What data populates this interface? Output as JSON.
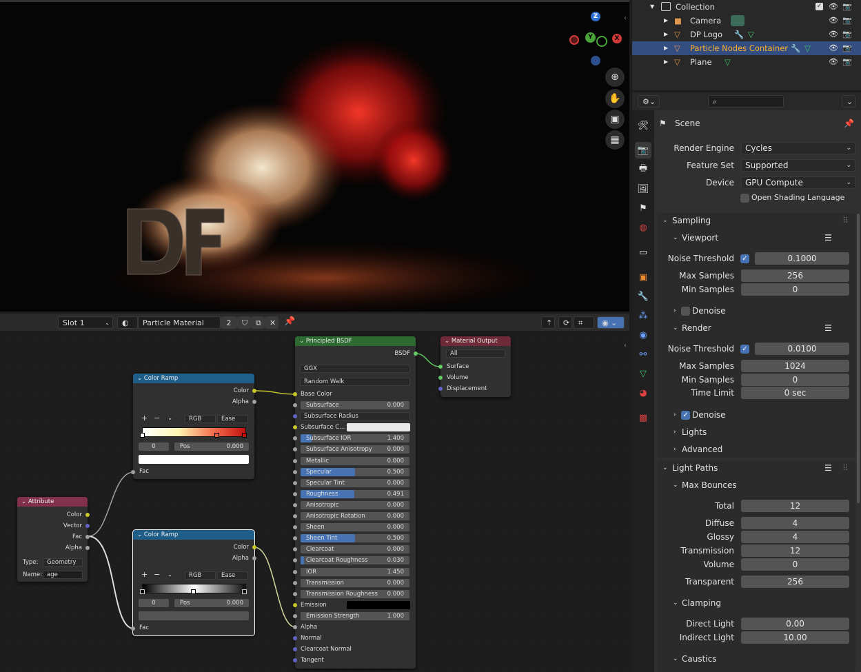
{
  "outliner": {
    "rows": [
      {
        "label": "Collection",
        "icon": "collection-icon"
      },
      {
        "label": "Camera",
        "icon": "camera-icon"
      },
      {
        "label": "DP Logo",
        "icon": "mesh-icon"
      },
      {
        "label": "Particle Nodes Container",
        "icon": "mesh-icon"
      },
      {
        "label": "Plane",
        "icon": "mesh-icon"
      }
    ]
  },
  "viewport": {
    "gizmo": {
      "z": "Z",
      "y": "Y",
      "x": "X"
    }
  },
  "node_header": {
    "slot": "Slot 1",
    "material_name": "Particle Material",
    "users": "2"
  },
  "nodes": {
    "color_ramp_1": {
      "title": "Color Ramp",
      "out_color": "Color",
      "out_alpha": "Alpha",
      "mode": "RGB",
      "interp": "Ease",
      "index": "0",
      "pos_label": "Pos",
      "pos_value": "0.000",
      "in_fac": "Fac",
      "plus": "+",
      "minus": "−"
    },
    "color_ramp_2": {
      "title": "Color Ramp",
      "out_color": "Color",
      "out_alpha": "Alpha",
      "mode": "RGB",
      "interp": "Ease",
      "index": "0",
      "pos_label": "Pos",
      "pos_value": "0.000",
      "in_fac": "Fac",
      "plus": "+",
      "minus": "−"
    },
    "attribute": {
      "title": "Attribute",
      "out_color": "Color",
      "out_vector": "Vector",
      "out_fac": "Fac",
      "out_alpha": "Alpha",
      "type_label": "Type:",
      "type_value": "Geometry",
      "name_label": "Name:",
      "name_value": "age"
    },
    "principled": {
      "title": "Principled BSDF",
      "out_bsdf": "BSDF",
      "distribution": "GGX",
      "subsurface_method": "Random Walk",
      "base_color": "Base Color",
      "fields": [
        {
          "label": "Subsurface",
          "value": "0.000",
          "fill": 0
        },
        {
          "label": "Subsurface IOR",
          "value": "1.400",
          "fill": 0.1
        },
        {
          "label": "Subsurface Anisotropy",
          "value": "0.000",
          "fill": 0
        },
        {
          "label": "Metallic",
          "value": "0.000",
          "fill": 0
        },
        {
          "label": "Specular",
          "value": "0.500",
          "fill": 0.5
        },
        {
          "label": "Specular Tint",
          "value": "0.000",
          "fill": 0
        },
        {
          "label": "Roughness",
          "value": "0.491",
          "fill": 0.491
        },
        {
          "label": "Anisotropic",
          "value": "0.000",
          "fill": 0
        },
        {
          "label": "Anisotropic Rotation",
          "value": "0.000",
          "fill": 0
        },
        {
          "label": "Sheen",
          "value": "0.000",
          "fill": 0
        },
        {
          "label": "Sheen Tint",
          "value": "0.500",
          "fill": 0.5
        },
        {
          "label": "Clearcoat",
          "value": "0.000",
          "fill": 0
        },
        {
          "label": "Clearcoat Roughness",
          "value": "0.030",
          "fill": 0.03
        },
        {
          "label": "IOR",
          "value": "1.450",
          "fill": 0
        },
        {
          "label": "Transmission",
          "value": "0.000",
          "fill": 0
        },
        {
          "label": "Transmission Roughness",
          "value": "0.000",
          "fill": 0
        }
      ],
      "subsurface_radius": "Subsurface Radius",
      "subsurface_color": "Subsurface C...",
      "emission": "Emission",
      "emission_strength": {
        "label": "Emission Strength",
        "value": "1.000"
      },
      "alpha": "Alpha",
      "normal": "Normal",
      "clearcoat_normal": "Clearcoat Normal",
      "tangent": "Tangent"
    },
    "material_output": {
      "title": "Material Output",
      "target": "All",
      "surface": "Surface",
      "volume": "Volume",
      "displacement": "Displacement"
    }
  },
  "properties": {
    "context": "Scene",
    "render_engine": {
      "label": "Render Engine",
      "value": "Cycles"
    },
    "feature_set": {
      "label": "Feature Set",
      "value": "Supported"
    },
    "device": {
      "label": "Device",
      "value": "GPU Compute"
    },
    "osl": "Open Shading Language",
    "sampling": {
      "title": "Sampling",
      "viewport": {
        "title": "Viewport",
        "noise_threshold": {
          "label": "Noise Threshold",
          "value": "0.1000"
        },
        "max_samples": {
          "label": "Max Samples",
          "value": "256"
        },
        "min_samples": {
          "label": "Min Samples",
          "value": "0"
        },
        "denoise": "Denoise"
      },
      "render": {
        "title": "Render",
        "noise_threshold": {
          "label": "Noise Threshold",
          "value": "0.0100"
        },
        "max_samples": {
          "label": "Max Samples",
          "value": "1024"
        },
        "min_samples": {
          "label": "Min Samples",
          "value": "0"
        },
        "time_limit": {
          "label": "Time Limit",
          "value": "0 sec"
        },
        "denoise": "Denoise"
      },
      "lights": "Lights",
      "advanced": "Advanced"
    },
    "light_paths": {
      "title": "Light Paths",
      "max_bounces": "Max Bounces",
      "total": {
        "label": "Total",
        "value": "12"
      },
      "diffuse": {
        "label": "Diffuse",
        "value": "4"
      },
      "glossy": {
        "label": "Glossy",
        "value": "4"
      },
      "transmission": {
        "label": "Transmission",
        "value": "12"
      },
      "volume": {
        "label": "Volume",
        "value": "0"
      },
      "transparent": {
        "label": "Transparent",
        "value": "256"
      },
      "clamping": "Clamping",
      "direct_light": {
        "label": "Direct Light",
        "value": "0.00"
      },
      "indirect_light": {
        "label": "Indirect Light",
        "value": "10.00"
      },
      "caustics": "Caustics"
    }
  },
  "colors": {
    "accent": "#4772b3",
    "selected_row": "#334d80",
    "active_object_text": "#ffaf29"
  }
}
